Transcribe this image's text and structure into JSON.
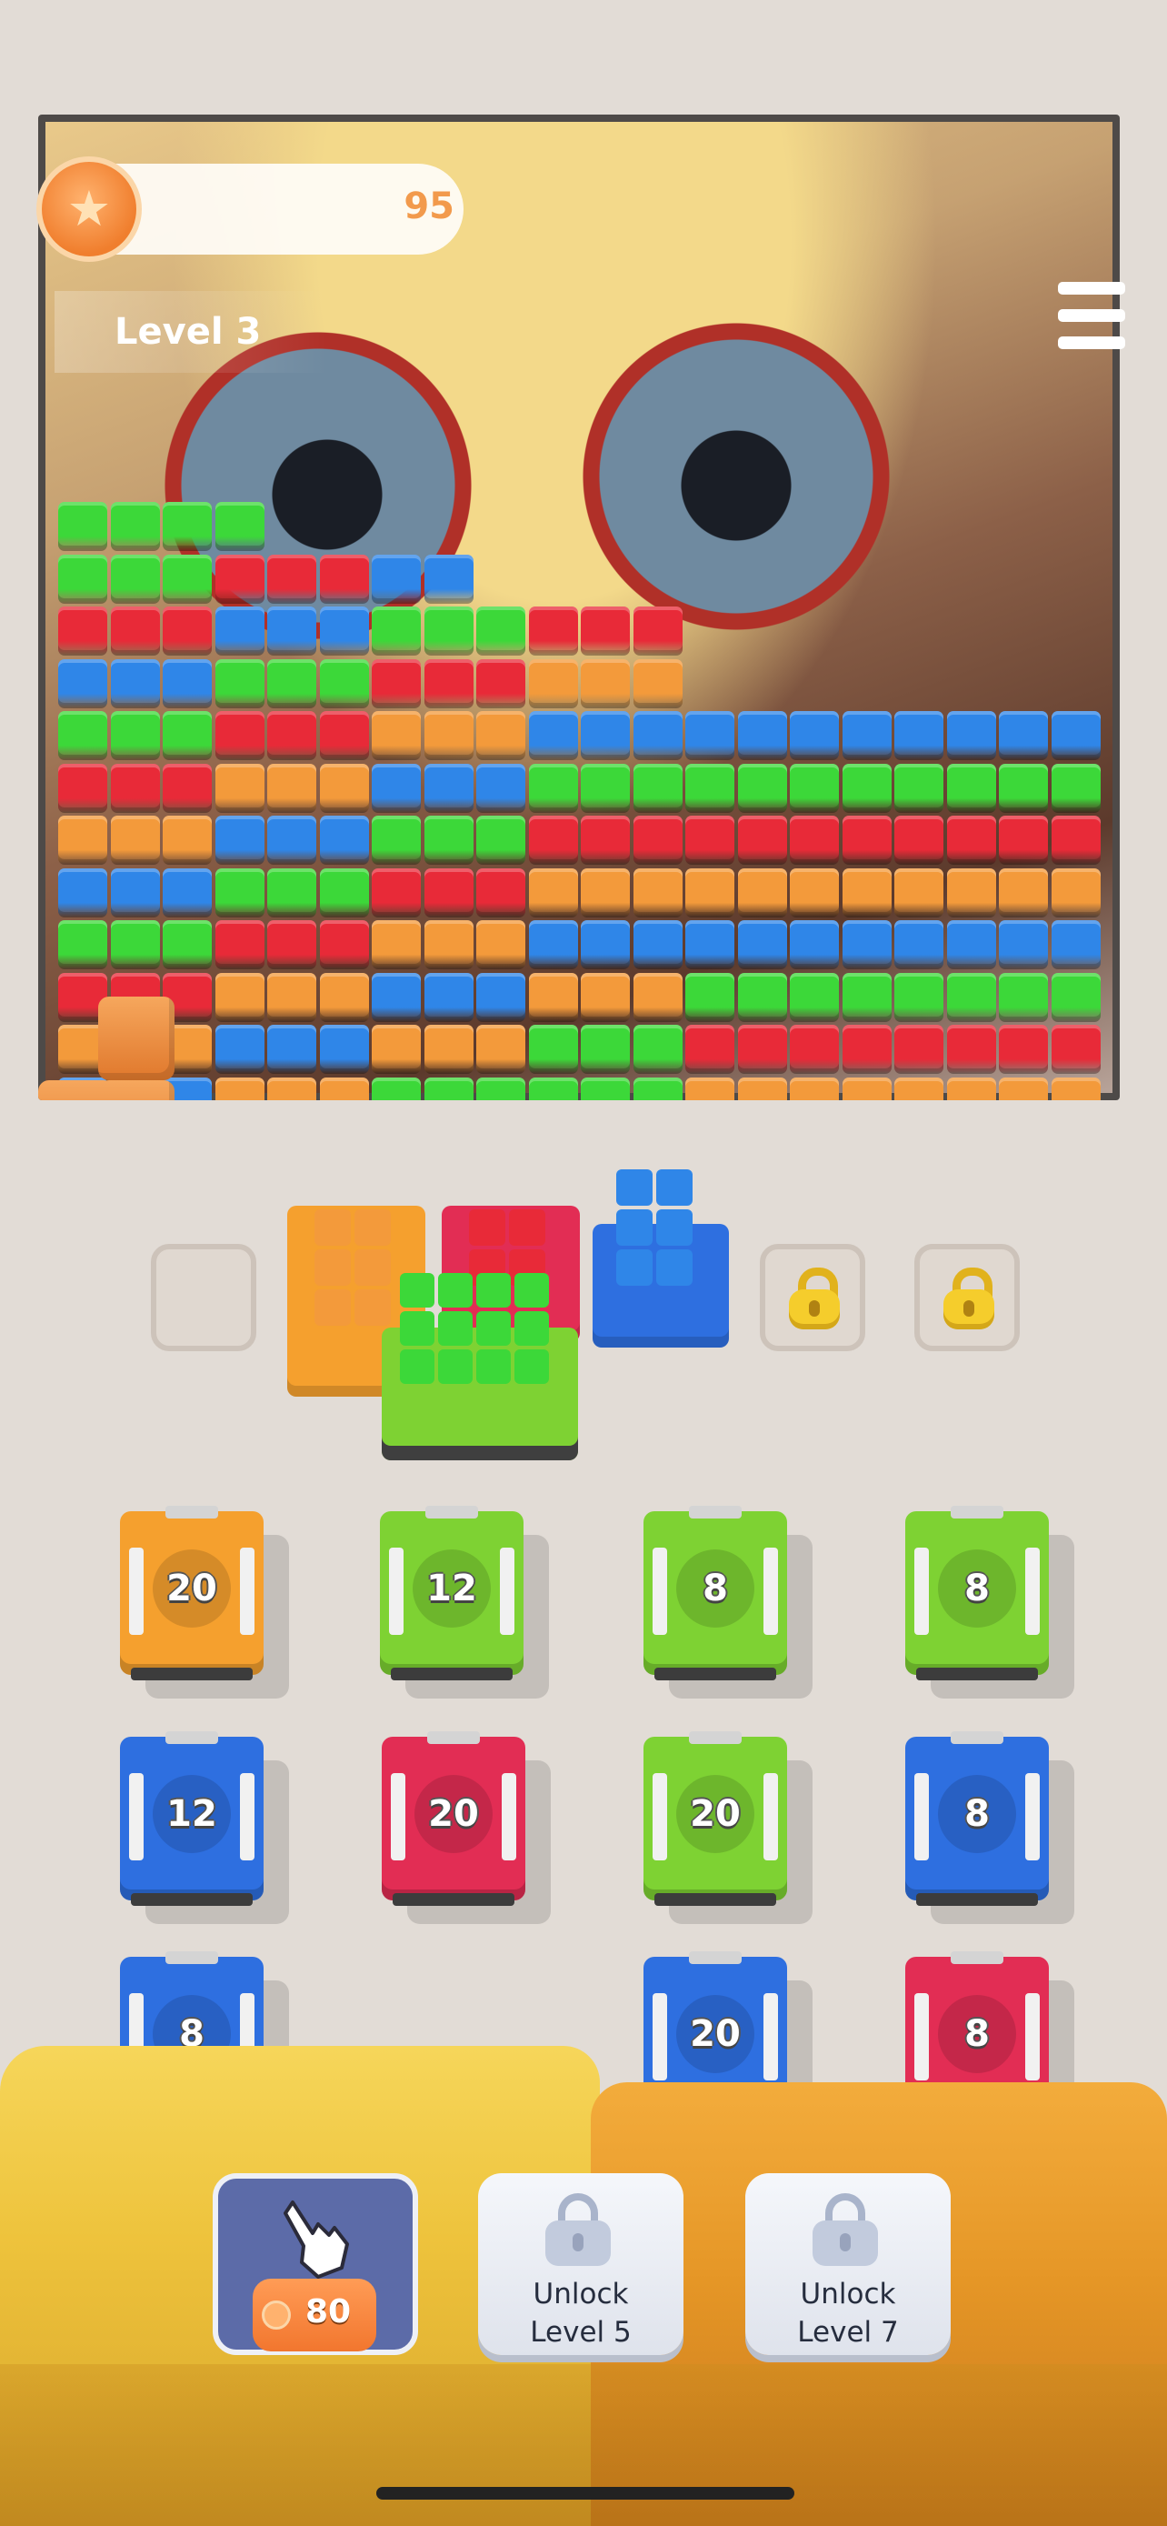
{
  "hud": {
    "coins": "95",
    "level": "Level 3",
    "icons": {
      "coin": "coin-star-icon",
      "menu": "hamburger-menu-icon"
    }
  },
  "board": {
    "description_colors": {
      "green": "#3cd839",
      "red": "#e82a38",
      "blue": "#2f86e8",
      "orange": "#f39a3b"
    }
  },
  "parking_slots": [
    {
      "state": "empty"
    },
    {
      "state": "occupied",
      "color": "orange"
    },
    {
      "state": "occupied",
      "color": "red"
    },
    {
      "state": "occupied",
      "color": "blue"
    },
    {
      "state": "locked",
      "icon": "padlock-icon"
    },
    {
      "state": "locked",
      "icon": "padlock-icon"
    }
  ],
  "trucks": [
    {
      "color": "orange",
      "capacity": "20"
    },
    {
      "color": "green",
      "capacity": "12"
    },
    {
      "color": "green",
      "capacity": "8"
    },
    {
      "color": "green",
      "capacity": "8"
    },
    {
      "color": "blue",
      "capacity": "12"
    },
    {
      "color": "red",
      "capacity": "20"
    },
    {
      "color": "green",
      "capacity": "20"
    },
    {
      "color": "blue",
      "capacity": "8"
    },
    {
      "color": "blue",
      "capacity": "8"
    },
    {
      "color": "blue",
      "capacity": "20"
    },
    {
      "color": "red",
      "capacity": "8"
    }
  ],
  "tools": {
    "magnet": {
      "icon": "pointing-hand-icon",
      "price": "80"
    },
    "locked_1": {
      "icon": "lock-icon",
      "line1": "Unlock",
      "line2": "Level 5"
    },
    "locked_2": {
      "icon": "lock-icon",
      "line1": "Unlock",
      "line2": "Level 7"
    }
  },
  "palette": {
    "green": "#3cd839",
    "red": "#e82a38",
    "blue": "#2f86e8",
    "orange": "#f39a3b",
    "truck_green": "#7ed233",
    "truck_orange": "#f5a02e",
    "truck_blue": "#2e6fe0",
    "truck_red": "#e22d54"
  }
}
